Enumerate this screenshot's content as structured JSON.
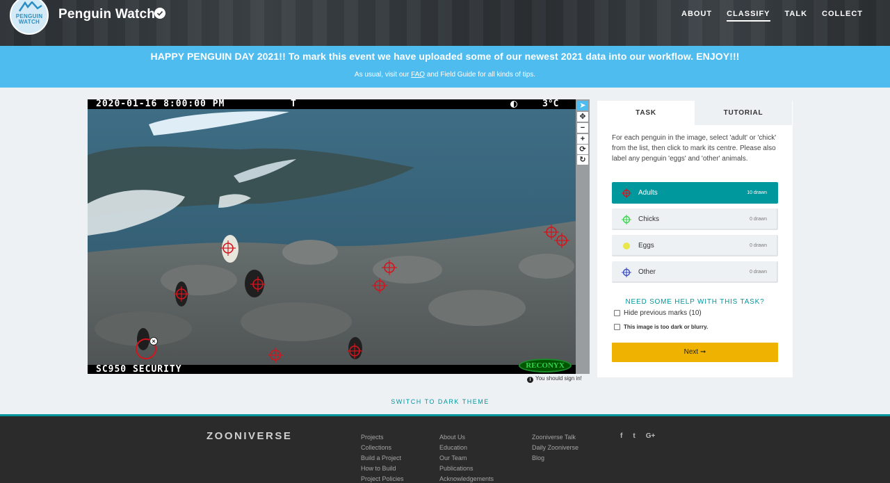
{
  "header": {
    "logo_text": "PENGUIN WATCH",
    "title": "Penguin Watch",
    "nav": [
      "ABOUT",
      "CLASSIFY",
      "TALK",
      "COLLECT"
    ],
    "active_nav": "CLASSIFY"
  },
  "announcement": {
    "main": "HAPPY PENGUIN DAY 2021!! To mark this event we have uploaded some of our newest 2021 data into our workflow. ENJOY!!!",
    "sub_before": "As usual, visit our ",
    "sub_link": "FAQ",
    "sub_after": " and Field Guide for all kinds of tips."
  },
  "subject": {
    "timestamp": "2020-01-16 8:00:00 PM",
    "flag": "T",
    "temperature": "3°C",
    "camera_id": "SC950 SECURITY",
    "brand": "RECONYX",
    "sign_in_notice": "You should sign in!"
  },
  "toolbar": {
    "tools": [
      {
        "name": "pointer-tool",
        "glyph": "➤",
        "active": true
      },
      {
        "name": "pan-tool",
        "glyph": "✥"
      },
      {
        "name": "zoom-out-tool",
        "glyph": "−"
      },
      {
        "name": "zoom-in-tool",
        "glyph": "+"
      },
      {
        "name": "rotate-tool",
        "glyph": "⟳"
      },
      {
        "name": "reset-tool",
        "glyph": "↻"
      }
    ]
  },
  "task_panel": {
    "tabs": [
      "TASK",
      "TUTORIAL"
    ],
    "instructions": "For each penguin in the image, select 'adult' or 'chick' from the list, then click to mark its centre. Please also label any penguin 'eggs' and 'other' animals.",
    "options": [
      {
        "label": "Adults",
        "count": "10 drawn",
        "color": "#d4141d",
        "selected": true
      },
      {
        "label": "Chicks",
        "count": "0 drawn",
        "color": "#37d64a"
      },
      {
        "label": "Eggs",
        "count": "0 drawn",
        "color": "#e7e64a"
      },
      {
        "label": "Other",
        "count": "0 drawn",
        "color": "#3b4fc4"
      }
    ],
    "help": "NEED SOME HELP WITH THIS TASK?",
    "hide_marks": "Hide previous marks (10)",
    "too_dark": "This image is too dark or blurry.",
    "next": "Next ➞"
  },
  "dark_theme": "SWITCH TO DARK THEME",
  "footer": {
    "brand": "ZOONIVERSE",
    "col1": [
      "Projects",
      "Collections",
      "Build a Project",
      "How to Build",
      "Project Policies"
    ],
    "col2": [
      "About Us",
      "Education",
      "Our Team",
      "Publications",
      "Acknowledgements"
    ],
    "col3": [
      "Zooniverse Talk",
      "Daily Zooniverse",
      "Blog"
    ],
    "social": [
      "f",
      "t",
      "G+"
    ]
  },
  "colors": {
    "accent": "#00979d",
    "banner": "#4fbcef",
    "next_button": "#f0b200",
    "mark": "#d4141d"
  }
}
